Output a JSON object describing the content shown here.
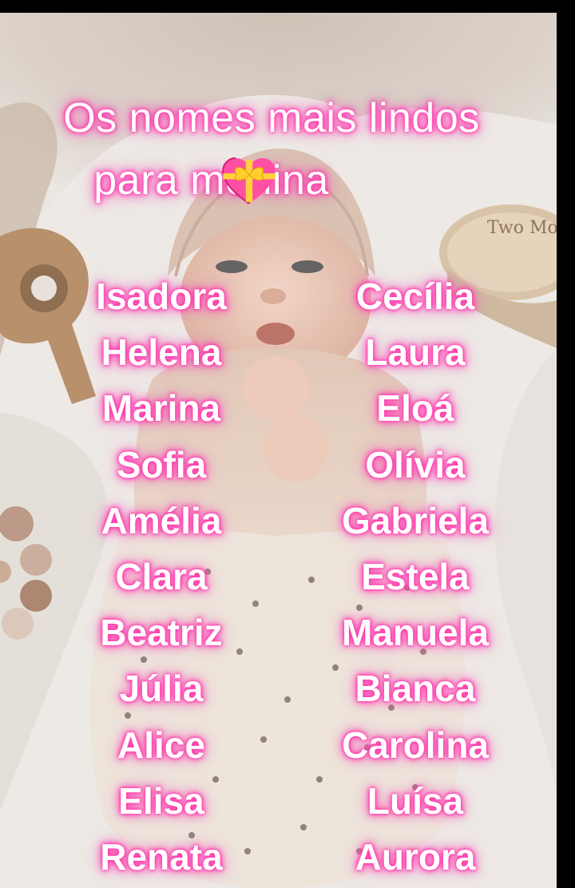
{
  "title": {
    "line1": "Os nomes mais lindos",
    "line2": "para menina",
    "emoji_icon": "heart-with-ribbon-icon"
  },
  "names_left": [
    "Isadora",
    "Helena",
    "Marina",
    "Sofia",
    "Amélia",
    "Clara",
    "Beatriz",
    "Júlia",
    "Alice",
    "Elisa",
    "Renata"
  ],
  "names_right": [
    "Cecília",
    "Laura",
    "Eloá",
    "Olívia",
    "Gabriela",
    "Estela",
    "Manuela",
    "Bianca",
    "Carolina",
    "Luísa",
    "Aurora"
  ],
  "props": {
    "sign_text": "Two Month"
  },
  "colors": {
    "glow": "#ff2ea8",
    "text": "#ffffff",
    "background": "#000000"
  }
}
